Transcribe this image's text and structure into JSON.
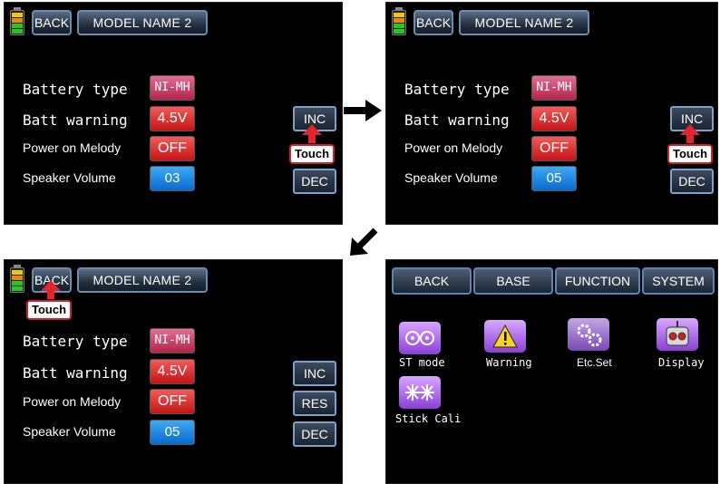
{
  "colors": {
    "pink": "#c83a64",
    "red": "#d41e1e",
    "blue": "#1e8ae6",
    "arrow": "#e0252e"
  },
  "panels": [
    {
      "back": "BACK",
      "model": "MODEL NAME  2",
      "rows": [
        {
          "label": "Battery type",
          "value": "NI-MH"
        },
        {
          "label": "Batt warning",
          "value": "4.5V"
        },
        {
          "label": "Power on Melody",
          "value": "OFF"
        },
        {
          "label": "Speaker Volume",
          "value": "03"
        }
      ],
      "side": {
        "inc": "INC",
        "dec": "DEC"
      },
      "touch": "Touch"
    },
    {
      "back": "BACK",
      "model": "MODEL NAME  2",
      "rows": [
        {
          "label": "Battery type",
          "value": "NI-MH"
        },
        {
          "label": "Batt warning",
          "value": "4.5V"
        },
        {
          "label": "Power on Melody",
          "value": "OFF"
        },
        {
          "label": "Speaker Volume",
          "value": "05"
        }
      ],
      "side": {
        "inc": "INC",
        "dec": "DEC"
      },
      "touch": "Touch"
    },
    {
      "back": "BACK",
      "model": "MODEL NAME  2",
      "rows": [
        {
          "label": "Battery type",
          "value": "NI-MH"
        },
        {
          "label": "Batt warning",
          "value": "4.5V"
        },
        {
          "label": "Power on Melody",
          "value": "OFF"
        },
        {
          "label": "Speaker Volume",
          "value": "05"
        }
      ],
      "side": {
        "inc": "INC",
        "res": "RES",
        "dec": "DEC"
      },
      "touch": "Touch"
    }
  ],
  "menu": {
    "tabs": [
      "BACK",
      "BASE",
      "FUNCTION",
      "SYSTEM"
    ],
    "icons": [
      {
        "label": "ST mode",
        "icon": "st-mode-icon"
      },
      {
        "label": "Warning",
        "icon": "warning-icon"
      },
      {
        "label": "Etc.Set",
        "icon": "gears-icon"
      },
      {
        "label": "Display",
        "icon": "robot-display-icon"
      },
      {
        "label": "Stick Cali",
        "icon": "stick-calibration-icon"
      }
    ]
  }
}
